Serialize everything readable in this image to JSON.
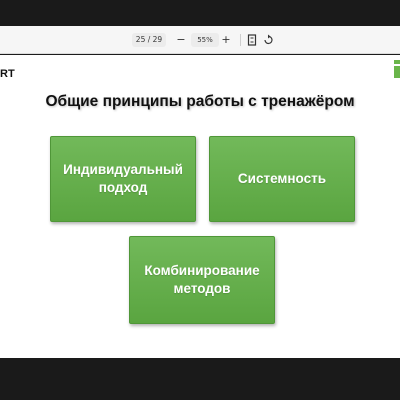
{
  "toolbar": {
    "page_indicator": "25 / 29",
    "zoom_out_label": "−",
    "zoom_level": "55%",
    "zoom_in_label": "+",
    "fit_icon": "fit-page-icon",
    "rotate_icon": "rotate-icon"
  },
  "slide": {
    "brand_left": "RT",
    "brand_right_icon": "brand-logo-icon",
    "title": "Общие принципы работы с тренажёром",
    "boxes": [
      "Индивидуальный подход",
      "Системность",
      "Комбинирование методов"
    ],
    "box_color": "#63ae48"
  }
}
